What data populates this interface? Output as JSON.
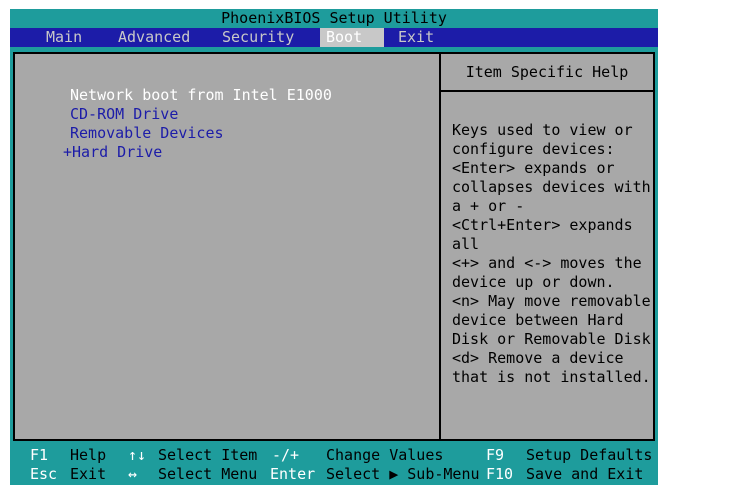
{
  "title": "PhoenixBIOS Setup Utility",
  "menu": [
    "Main",
    "Advanced",
    "Security",
    "Boot",
    "Exit"
  ],
  "active_menu": "Boot",
  "boot_items": [
    {
      "label": "Network boot from Intel E1000",
      "selected": true
    },
    {
      "label": "CD-ROM Drive",
      "selected": false
    },
    {
      "label": "Removable Devices",
      "selected": false
    },
    {
      "label": "+Hard Drive",
      "selected": false
    }
  ],
  "help": {
    "title": "Item Specific Help",
    "lines": [
      "Keys used to view or",
      "configure devices:",
      "<Enter> expands or",
      "collapses devices with",
      "a + or -",
      "<Ctrl+Enter> expands",
      "all",
      "<+> and <-> moves the",
      "device up or down.",
      "<n> May move removable",
      "device between Hard",
      "Disk or Removable Disk",
      "<d> Remove a device",
      "that is not installed."
    ]
  },
  "footer": {
    "row1": [
      {
        "key": "F1",
        "desc": "Help"
      },
      {
        "key": "↑↓",
        "desc": "Select Item"
      },
      {
        "key": "-/+",
        "desc": "Change Values"
      },
      {
        "key": "F9",
        "desc": "Setup Defaults"
      }
    ],
    "row2": [
      {
        "key": "Esc",
        "desc": "Exit"
      },
      {
        "key": "↔",
        "desc": "Select Menu"
      },
      {
        "key": "Enter",
        "desc": "Select ▶ Sub-Menu"
      },
      {
        "key": "F10",
        "desc": "Save and Exit"
      }
    ]
  },
  "colors": {
    "teal": "#1e9c9c",
    "blue": "#1c1ca8",
    "gray": "#a8a8a8"
  }
}
